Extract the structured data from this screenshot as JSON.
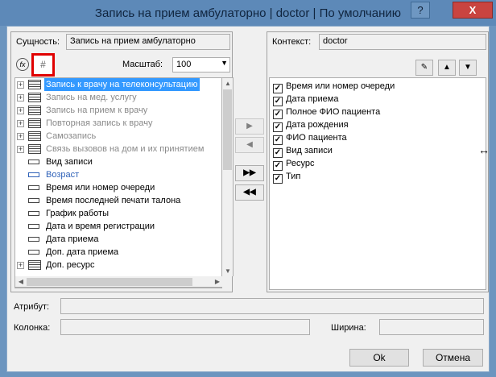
{
  "window": {
    "title": "Запись на прием амбулаторно | doctor | По умолчанию",
    "help_glyph": "?",
    "close_glyph": "X"
  },
  "left": {
    "entity_label": "Сущность:",
    "entity_value": "Запись на прием амбулаторно",
    "fx_glyph": "fx",
    "grid_glyph": "#",
    "scale_label": "Масштаб:",
    "scale_value": "100",
    "tree": [
      {
        "text": "Запись к врачу на телеконсультацию",
        "kind": "entity",
        "style": "selected"
      },
      {
        "text": "Запись на мед. услугу",
        "kind": "entity",
        "style": "gray"
      },
      {
        "text": "Запись на прием к врачу",
        "kind": "entity",
        "style": "gray"
      },
      {
        "text": "Повторная запись к врачу",
        "kind": "entity",
        "style": "gray"
      },
      {
        "text": "Самозапись",
        "kind": "entity",
        "style": "gray"
      },
      {
        "text": "Связь вызовов на дом и их принятием",
        "kind": "entity",
        "style": "gray"
      },
      {
        "text": "Вид записи",
        "kind": "attr",
        "style": "normal"
      },
      {
        "text": "Возраст",
        "kind": "attr-blue",
        "style": "blue"
      },
      {
        "text": "Время или номер очереди",
        "kind": "attr",
        "style": "normal"
      },
      {
        "text": "Время последней печати талона",
        "kind": "attr",
        "style": "normal"
      },
      {
        "text": "График работы",
        "kind": "attr",
        "style": "normal"
      },
      {
        "text": "Дата и время регистрации",
        "kind": "attr",
        "style": "normal"
      },
      {
        "text": "Дата приема",
        "kind": "attr",
        "style": "normal"
      },
      {
        "text": "Доп. дата приема",
        "kind": "attr",
        "style": "normal"
      },
      {
        "text": "Доп. ресурс",
        "kind": "entity",
        "style": "normal"
      }
    ]
  },
  "move": {
    "right": "▶",
    "left": "◀",
    "all_right": "▶▶",
    "all_left": "◀◀"
  },
  "right": {
    "context_label": "Контекст:",
    "context_value": "doctor",
    "edit_glyph": "✎",
    "up_glyph": "▲",
    "down_glyph": "▼",
    "columns": [
      "Время или номер очереди",
      "Дата приема",
      "Полное ФИО пациента",
      "Дата рождения",
      "ФИО пациента",
      "Вид записи",
      "Ресурс",
      "Тип"
    ]
  },
  "bottom": {
    "attribute_label": "Атрибут:",
    "attribute_value": "",
    "column_label": "Колонка:",
    "column_value": "",
    "width_label": "Ширина:",
    "width_value": "",
    "ok": "Ok",
    "cancel": "Отмена"
  }
}
